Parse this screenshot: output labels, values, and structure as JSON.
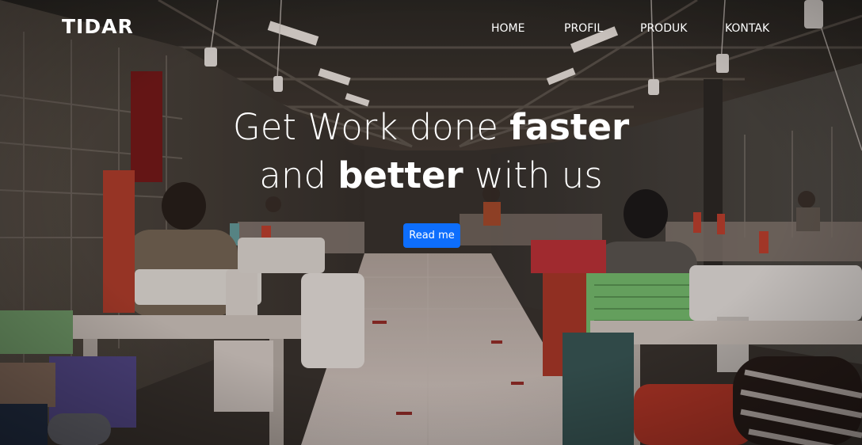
{
  "brand": "TIDAR",
  "nav": {
    "items": [
      "HOME",
      "PROFIL",
      "PRODUK",
      "KONTAK"
    ]
  },
  "hero": {
    "line1_light": "Get Work done ",
    "line1_bold": "faster",
    "line2_light_a": "and ",
    "line2_bold": "better",
    "line2_light_b": " with us",
    "button_label": "Read me",
    "background": "garment-factory-photo"
  },
  "colors": {
    "accent": "#0d6efd",
    "text": "#ffffff"
  }
}
